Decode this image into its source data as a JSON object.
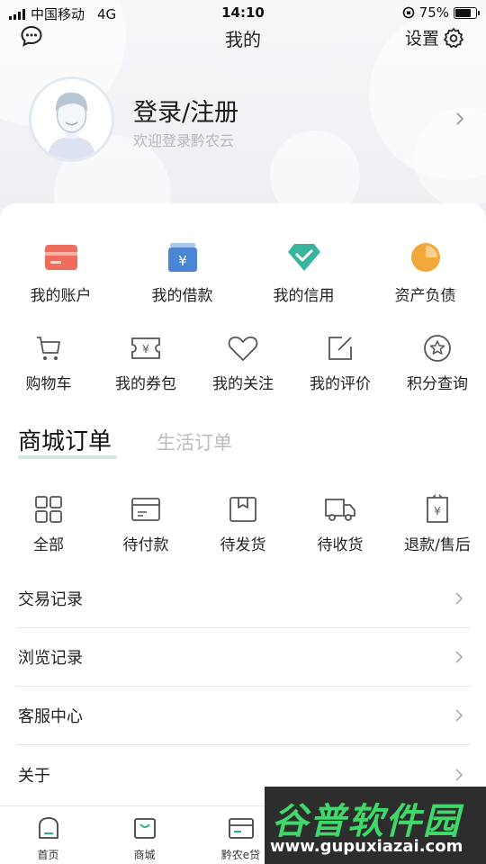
{
  "status_bar": {
    "carrier": "中国移动",
    "network": "4G",
    "time": "14:10",
    "battery_percent": "75%",
    "battery_level": 0.75
  },
  "nav": {
    "title": "我的",
    "settings_label": "设置"
  },
  "profile": {
    "login_label": "登录/注册",
    "welcome_text": "欢迎登录黔农云"
  },
  "finance": [
    {
      "label": "我的账户",
      "icon": "card-icon",
      "color": "#ef6d5d"
    },
    {
      "label": "我的借款",
      "icon": "yuan-box-icon",
      "color": "#4b86d6"
    },
    {
      "label": "我的信用",
      "icon": "diamond-icon",
      "color": "#39b59d"
    },
    {
      "label": "资产负债",
      "icon": "pie-icon",
      "color": "#f2a73b"
    }
  ],
  "services": [
    {
      "label": "购物车",
      "icon": "cart-icon"
    },
    {
      "label": "我的券包",
      "icon": "coupon-icon"
    },
    {
      "label": "我的关注",
      "icon": "heart-icon"
    },
    {
      "label": "我的评价",
      "icon": "edit-icon"
    },
    {
      "label": "积分查询",
      "icon": "star-icon"
    }
  ],
  "order_tabs": {
    "active": "商城订单",
    "inactive": "生活订单"
  },
  "orders": [
    {
      "label": "全部",
      "icon": "grid-icon"
    },
    {
      "label": "待付款",
      "icon": "wallet-icon"
    },
    {
      "label": "待发货",
      "icon": "box-icon"
    },
    {
      "label": "待收货",
      "icon": "truck-icon"
    },
    {
      "label": "退款/售后",
      "icon": "refund-icon"
    }
  ],
  "menu": [
    {
      "label": "交易记录"
    },
    {
      "label": "浏览记录"
    },
    {
      "label": "客服中心"
    },
    {
      "label": "关于"
    }
  ],
  "tabbar": [
    {
      "label": "首页",
      "icon": "home-icon"
    },
    {
      "label": "商城",
      "icon": "shop-bag-icon"
    },
    {
      "label": "黔农e贷",
      "icon": "loan-icon"
    }
  ],
  "watermark": {
    "name": "谷普软件园",
    "url": "www.gupuxiazai.com"
  }
}
